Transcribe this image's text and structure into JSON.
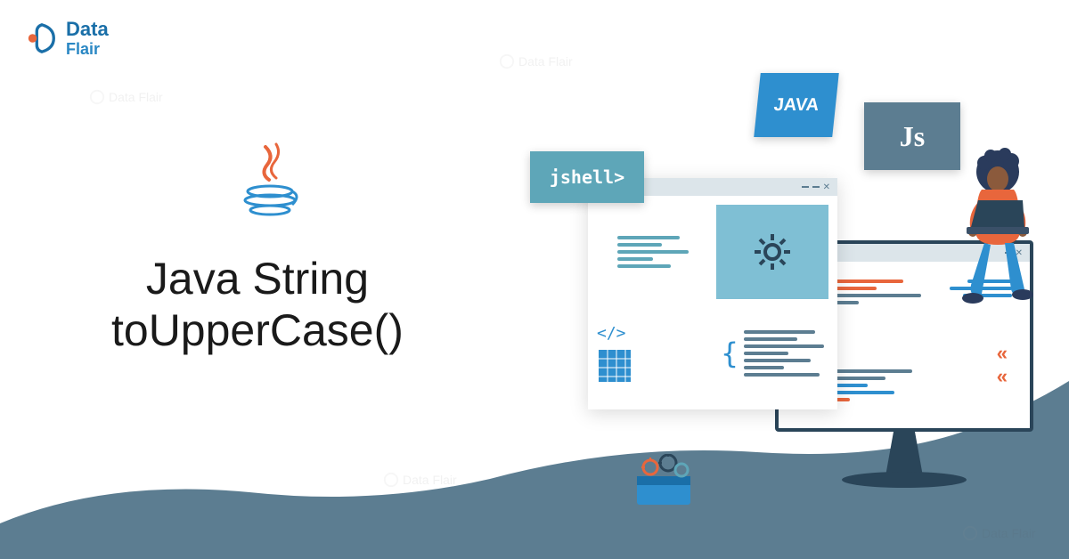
{
  "logo": {
    "data": "Data",
    "flair": "Flair"
  },
  "title": {
    "line1": "Java String",
    "line2": "toUpperCase()"
  },
  "badges": {
    "java": "JAVA",
    "js": "Js",
    "jshell": "jshell>"
  },
  "watermark": {
    "data": "Data",
    "flair": "Flair"
  },
  "colors": {
    "primary": "#2e8fcf",
    "slate": "#5c7d91",
    "teal": "#5ea6b8",
    "dark": "#2a4559",
    "orange": "#e8663c"
  }
}
